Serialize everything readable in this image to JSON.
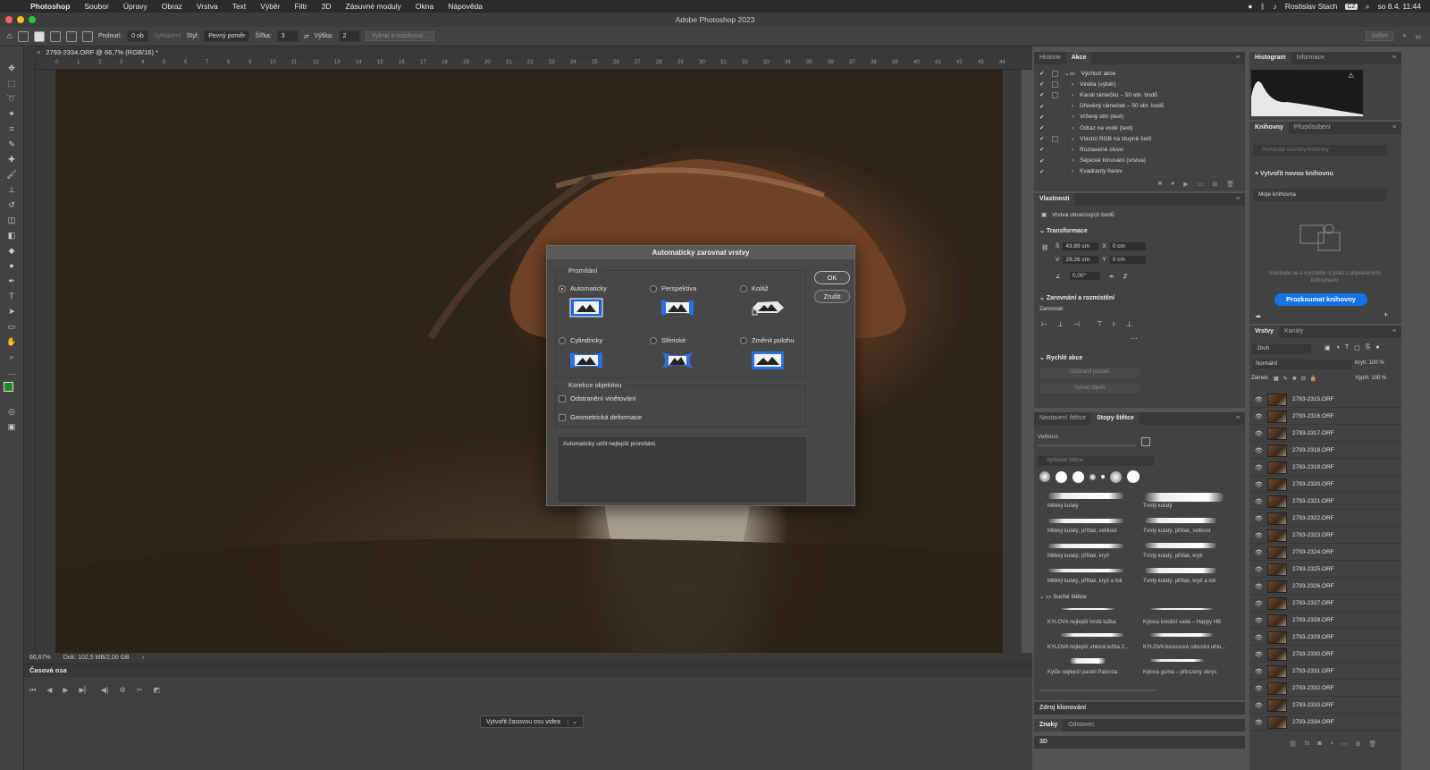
{
  "menubar": {
    "app": "Photoshop",
    "items": [
      "Soubor",
      "Úpravy",
      "Obraz",
      "Vrstva",
      "Text",
      "Výběr",
      "Filtr",
      "3D",
      "Zásuvné moduly",
      "Okna",
      "Nápověda"
    ],
    "user": "Rostislav Stach",
    "keyboard": "CZ",
    "datetime": "so 8.4.  11:44"
  },
  "window": {
    "title": "Adobe Photoshop 2023"
  },
  "options": {
    "feather_label": "Prolnutí:",
    "feather_value": "0 ob",
    "smooth_label": "Vyhlazení",
    "style_label": "Styl:",
    "style_value": "Pevný poměr",
    "width_label": "Šířka:",
    "width_value": "3",
    "height_label": "Výška:",
    "height_value": "2",
    "select_mask": "Vybrat a maskovat...",
    "share": "Sdílet"
  },
  "document": {
    "tab": "2793-2334.ORF @ 66,7% (RGB/16) *",
    "zoom": "66,67%",
    "doc_info": "Dok: 102,5 MB/2,00 GB"
  },
  "ruler": {
    "ticks": [
      "0",
      "1",
      "2",
      "3",
      "4",
      "5",
      "6",
      "7",
      "8",
      "9",
      "10",
      "11",
      "12",
      "13",
      "14",
      "15",
      "16",
      "17",
      "18",
      "19",
      "20",
      "21",
      "22",
      "23",
      "24",
      "25",
      "26",
      "27",
      "28",
      "29",
      "30",
      "31",
      "32",
      "33",
      "34",
      "35",
      "36",
      "37",
      "38",
      "39",
      "40",
      "41",
      "42",
      "43",
      "44"
    ]
  },
  "timeline": {
    "title": "Časová osa",
    "create_button": "Vytvořit časovou osu videa"
  },
  "dialog": {
    "title": "Automaticky zarovnat vrstvy",
    "projection_label": "Promítání",
    "options": [
      {
        "label": "Automaticky",
        "selected": true
      },
      {
        "label": "Perspektiva",
        "selected": false
      },
      {
        "label": "Koláž",
        "selected": false
      },
      {
        "label": "Cylindricky",
        "selected": false
      },
      {
        "label": "Sférické",
        "selected": false
      },
      {
        "label": "Změnit polohu",
        "selected": false
      }
    ],
    "lens_label": "Korekce objektivu",
    "lens_options": [
      {
        "label": "Odstranění vinětování",
        "checked": false
      },
      {
        "label": "Geometrická deformace",
        "checked": false
      }
    ],
    "ok": "OK",
    "cancel": "Zrušit",
    "description": "Automaticky určit nejlepší promítání."
  },
  "history_panel": {
    "tabs": [
      "Historie",
      "Akce"
    ],
    "active": "Akce",
    "items": [
      "Výchozí akce",
      "Viněta (výběr)",
      "Kanál rámečku – 50 obr. bodů",
      "Dřevěný rámeček – 50 obr. bodů",
      "Vržený stín (text)",
      "Odraz na vodě (text)",
      "Vlastní RGB na stupně šedi",
      "Roztavené olovo",
      "Sépiové tónování (vrstva)",
      "Kvadranty barev"
    ]
  },
  "properties": {
    "title": "Vlastnosti",
    "layer_type": "Vrstva obrazových bodů",
    "transform": "Transformace",
    "w_label": "Š",
    "w": "43,89 cm",
    "h_label": "V",
    "h": "29,26 cm",
    "x_label": "X",
    "x": "0 cm",
    "y_label": "Y",
    "y": "0 cm",
    "angle": "0,00°",
    "align_section": "Zarovnání a rozmístění",
    "align_label": "Zarovnat:",
    "quick_actions": "Rychlé akce",
    "remove_bg": "Odstranit pozadí",
    "select_subject": "Vybrat objekt"
  },
  "brushes": {
    "tabs": [
      "Nastavení štětce",
      "Stopy štětce"
    ],
    "active": "Stopy štětce",
    "size_label": "Velikost:",
    "search": "Vyhledat štětce",
    "items": [
      "Měkký kulatý",
      "Tvrdý kulatý",
      "Měkký kulatý, přítlak, velikost",
      "Tvrdý kulatý, přítlak, velikost",
      "Měkký kulatý, přítlak, krytí",
      "Tvrdý kulatý, přítlak, krytí",
      "Měkký kulatý, přítlak, krytí a tok",
      "Tvrdý kulatý, přítlak, krytí a tok"
    ],
    "group": "Suché štětce",
    "dry": [
      "KYLOVA nejlepší tvrdá tužka",
      "Kylova kreslicí sada – Happy HB",
      "KYLOVA nejlepší uhlová tužka 2...",
      "KYLOVA bonusová robustní uhlo...",
      "Kylův nejlepší pastel Palooza",
      "Kylova guma – přirozený obrys"
    ]
  },
  "clone_source": "Zdroj klonování",
  "char_tabs": [
    "Znaky",
    "Odstavec"
  ],
  "panel3d": "3D",
  "histogram": {
    "tabs": [
      "Histogram",
      "Informace"
    ]
  },
  "libraries": {
    "tabs": [
      "Knihovny",
      "Přizpůsobení"
    ],
    "search": "Prohledat všechny knihovny",
    "create": "Vytvořit novou knihovnu",
    "my_library": "Moje knihovna",
    "inspire": "Inspirujte se a urychlete si práci s připravenými knihovnami.",
    "explore": "Prozkoumat knihovny"
  },
  "layers": {
    "tabs": [
      "Vrstvy",
      "Kanály"
    ],
    "filter": "Druh",
    "blend": "Normální",
    "opacity_label": "Krytí:",
    "opacity": "100 %",
    "lock_label": "Zámek:",
    "fill_label": "Výplň:",
    "fill": "100 %",
    "items": [
      "2793-2315.ORF",
      "2793-2316.ORF",
      "2793-2317.ORF",
      "2793-2318.ORF",
      "2793-2319.ORF",
      "2793-2320.ORF",
      "2793-2321.ORF",
      "2793-2322.ORF",
      "2793-2323.ORF",
      "2793-2324.ORF",
      "2793-2325.ORF",
      "2793-2326.ORF",
      "2793-2327.ORF",
      "2793-2328.ORF",
      "2793-2329.ORF",
      "2793-2330.ORF",
      "2793-2331.ORF",
      "2793-2332.ORF",
      "2793-2333.ORF",
      "2793-2334.ORF"
    ]
  }
}
